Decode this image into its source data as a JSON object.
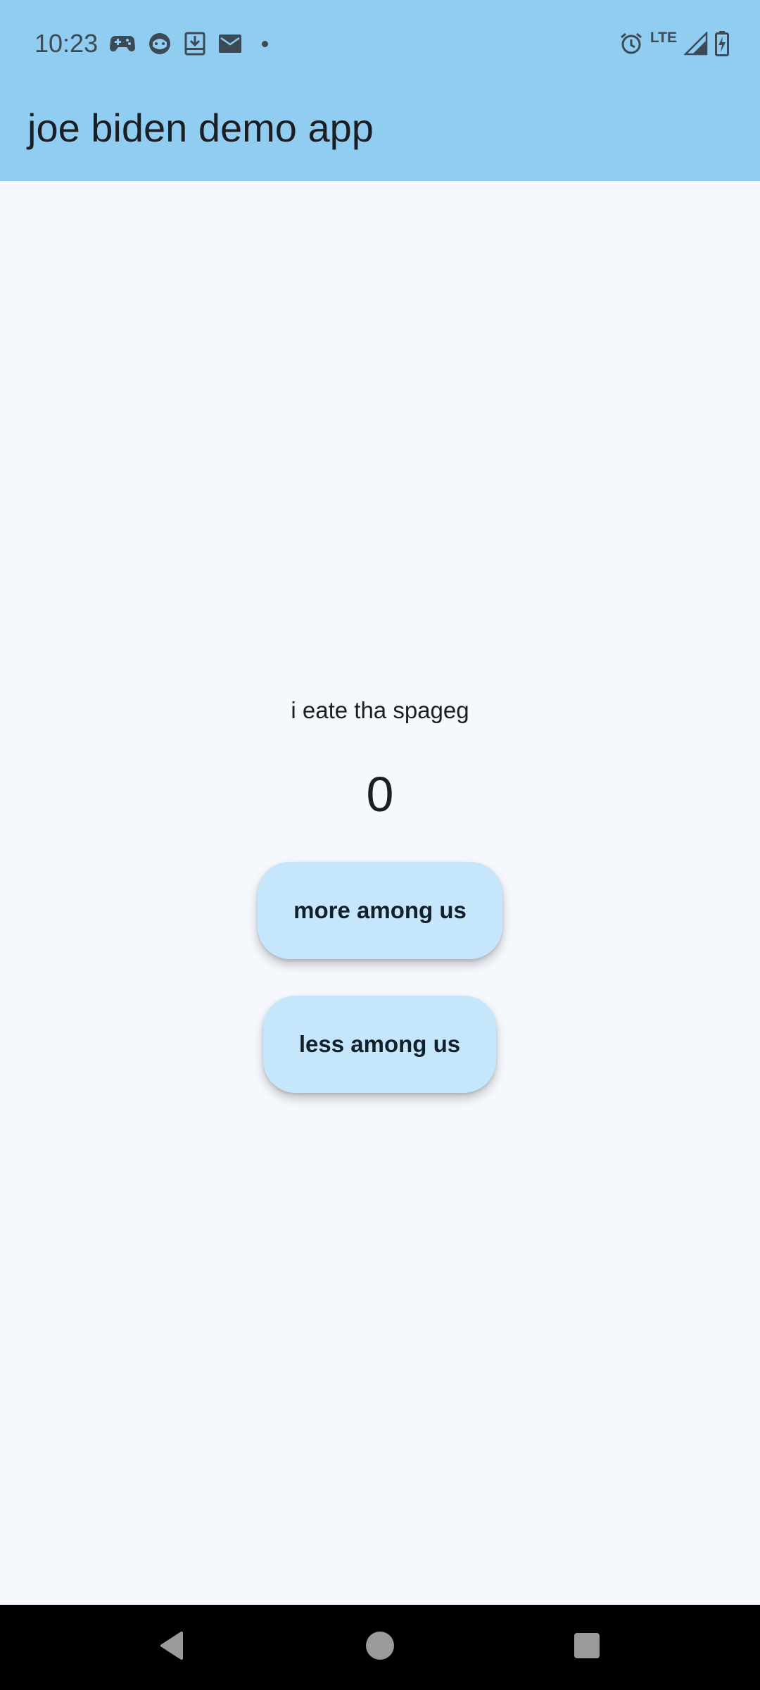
{
  "status_bar": {
    "time": "10:23",
    "network_label": "LTE",
    "left_icons": [
      "gamepad-icon",
      "cat-face-icon",
      "download-box-icon",
      "mail-icon",
      "notification-dot"
    ],
    "right_icons": [
      "alarm-icon",
      "lte-indicator",
      "cellular-signal-icon",
      "battery-charging-icon"
    ]
  },
  "app_bar": {
    "title": "joe biden demo app",
    "background_color": "#90cdf1"
  },
  "main": {
    "subtitle": "i eate tha spageg",
    "counter_value": "0",
    "buttons": {
      "increment_label": "more among us",
      "decrement_label": "less among us"
    },
    "button_color": "#c6e6fb",
    "background_color": "#f5f8fd"
  },
  "nav_bar": {
    "buttons": [
      "back-icon",
      "home-icon",
      "recents-icon"
    ]
  }
}
